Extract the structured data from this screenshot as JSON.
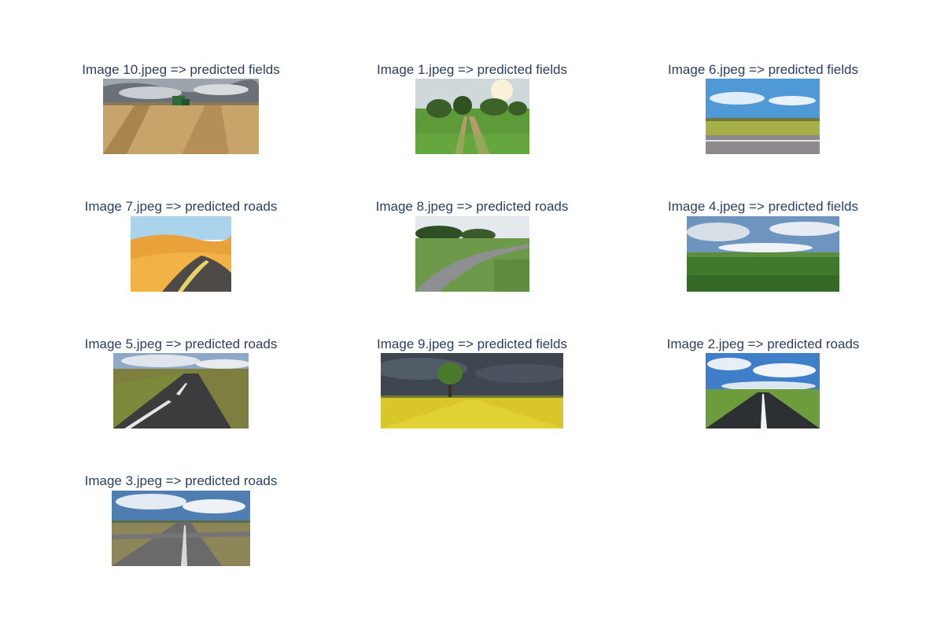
{
  "chart_data": {
    "type": "image_grid",
    "rows": 4,
    "cols": 3,
    "panels": [
      {
        "title": "Image 10.jpeg => predicted fields",
        "file": "Image 10.jpeg",
        "prediction": "fields",
        "scene": "wheat-harvest-icon"
      },
      {
        "title": "Image 1.jpeg => predicted fields",
        "file": "Image 1.jpeg",
        "prediction": "fields",
        "scene": "grass-path-trees-icon"
      },
      {
        "title": "Image 6.jpeg => predicted fields",
        "file": "Image 6.jpeg",
        "prediction": "fields",
        "scene": "sky-meadow-road-icon"
      },
      {
        "title": "Image 7.jpeg => predicted roads",
        "file": "Image 7.jpeg",
        "prediction": "roads",
        "scene": "desert-road-icon"
      },
      {
        "title": "Image 8.jpeg => predicted roads",
        "file": "Image 8.jpeg",
        "prediction": "roads",
        "scene": "country-lane-icon"
      },
      {
        "title": "Image 4.jpeg => predicted fields",
        "file": "Image 4.jpeg",
        "prediction": "fields",
        "scene": "green-plain-icon"
      },
      {
        "title": "Image 5.jpeg => predicted roads",
        "file": "Image 5.jpeg",
        "prediction": "roads",
        "scene": "moor-road-icon"
      },
      {
        "title": "Image 9.jpeg => predicted fields",
        "file": "Image 9.jpeg",
        "prediction": "fields",
        "scene": "rapeseed-tree-icon"
      },
      {
        "title": "Image 2.jpeg => predicted roads",
        "file": "Image 2.jpeg",
        "prediction": "roads",
        "scene": "highway-sky-icon"
      },
      {
        "title": "Image 3.jpeg => predicted roads",
        "file": "Image 3.jpeg",
        "prediction": "roads",
        "scene": "crossroad-icon"
      }
    ]
  }
}
